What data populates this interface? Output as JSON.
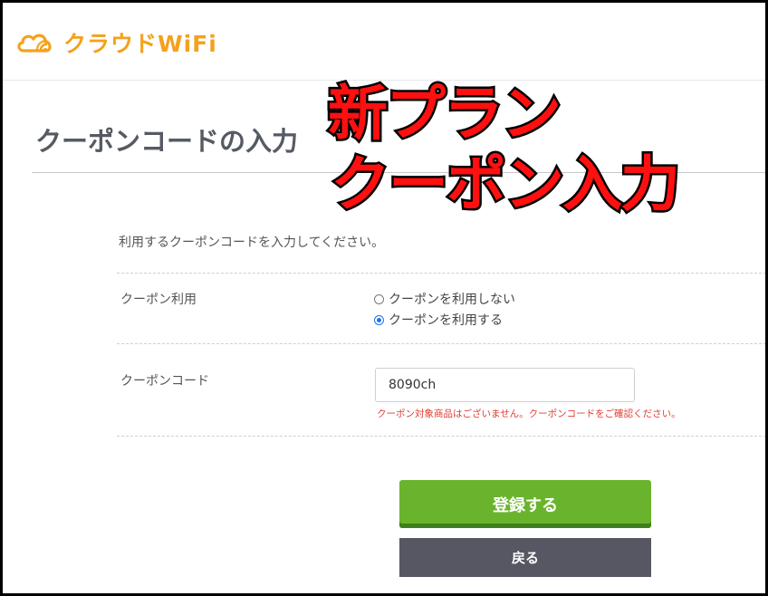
{
  "header": {
    "logo_text": "クラウドWiFi",
    "logo_icon": "cloud-wifi-icon",
    "brand_color": "#f4a11c"
  },
  "page": {
    "title": "クーポンコードの入力",
    "instruction": "利用するクーポンコードを入力してください。"
  },
  "coupon_usage": {
    "label": "クーポン利用",
    "options": [
      {
        "label": "クーポンを利用しない",
        "checked": false
      },
      {
        "label": "クーポンを利用する",
        "checked": true
      }
    ]
  },
  "coupon_code": {
    "label": "クーポンコード",
    "value": "8090ch",
    "error": "クーポン対象商品はございません。クーポンコードをご確認ください。",
    "error_color": "#e03c31"
  },
  "buttons": {
    "register_label": "登録する",
    "register_color": "#6ab42d",
    "back_label": "戻る",
    "back_color": "#565762"
  },
  "overlay": {
    "line1": "新プラン",
    "line2": "クーポン入力",
    "color": "#ff1010"
  }
}
